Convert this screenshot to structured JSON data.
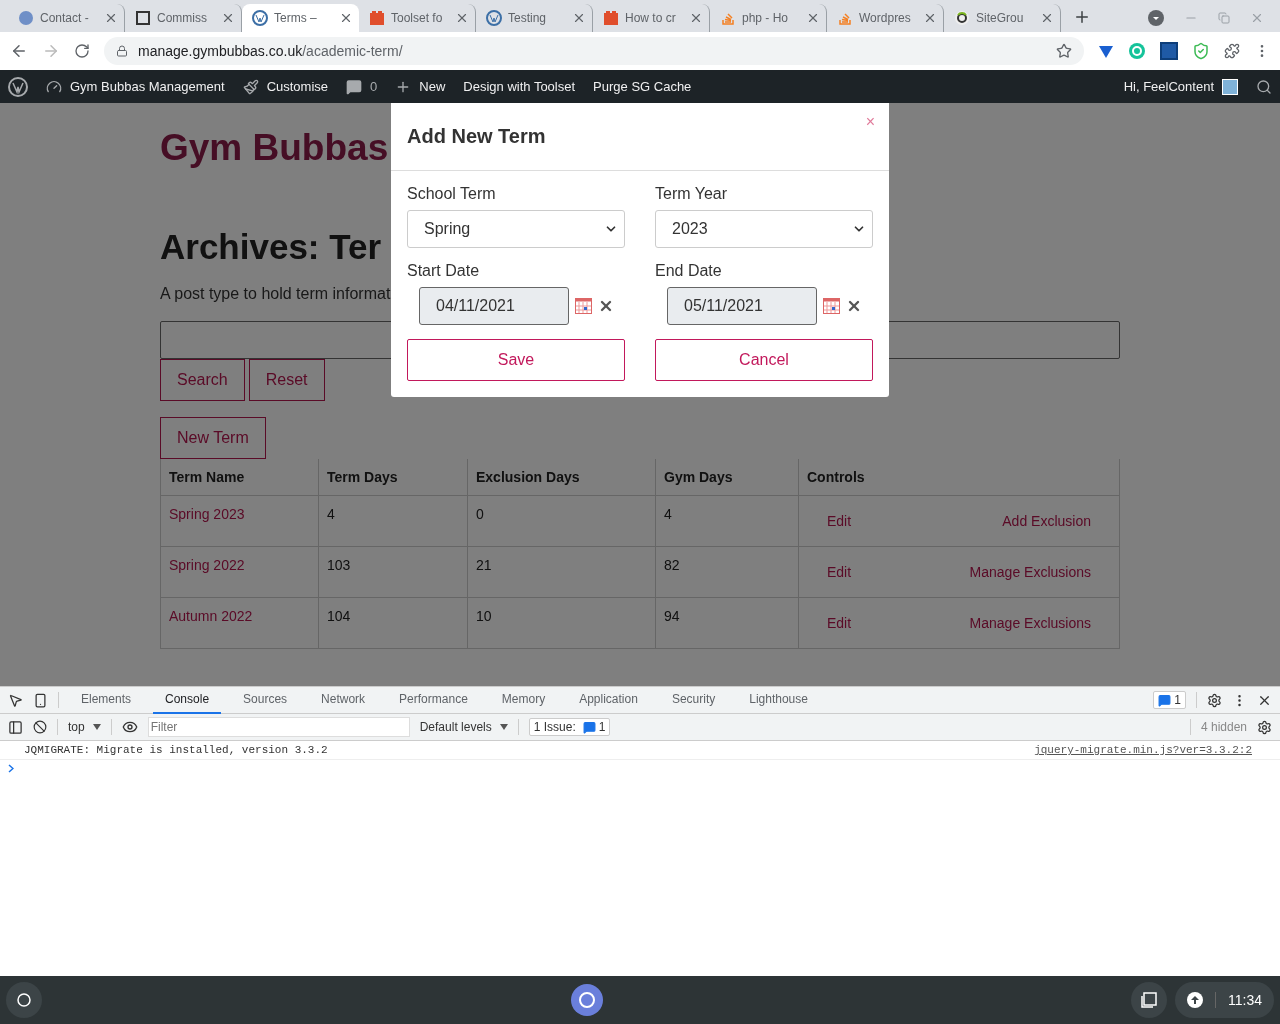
{
  "browser": {
    "tabs": [
      {
        "title": "Contact -",
        "kind": "circle",
        "selected": false
      },
      {
        "title": "Commiss",
        "kind": "frame",
        "selected": false
      },
      {
        "title": "Terms –",
        "kind": "wordpress",
        "selected": true
      },
      {
        "title": "Toolset fo",
        "kind": "block",
        "selected": false
      },
      {
        "title": "Testing",
        "kind": "wordpress",
        "selected": false
      },
      {
        "title": "How to cr",
        "kind": "block",
        "selected": false
      },
      {
        "title": "php - Ho",
        "kind": "stack",
        "selected": false
      },
      {
        "title": "Wordpres",
        "kind": "stack",
        "selected": false
      },
      {
        "title": "SiteGrou",
        "kind": "swirl",
        "selected": false
      }
    ],
    "url": {
      "host": "manage.gymbubbas.co.uk",
      "path": "/academic-term/"
    }
  },
  "admin_bar": {
    "site": "Gym Bubbas Management",
    "customise": "Customise",
    "comments": "0",
    "new": "New",
    "links": [
      "Design with Toolset",
      "Purge SG Cache"
    ],
    "greeting": "Hi, FeelContent"
  },
  "page": {
    "site_title": "Gym Bubbas",
    "archive_title": "Archives: Ter",
    "description": "A post type to hold term informat",
    "search_button": "Search",
    "reset_button": "Reset",
    "new_button": "New Term",
    "table": {
      "columns": [
        "Term Name",
        "Term Days",
        "Exclusion Days",
        "Gym Days",
        "Controls"
      ],
      "rows": [
        {
          "name": "Spring 2023",
          "term_days": "4",
          "exclusion_days": "0",
          "gym_days": "4",
          "edit": "Edit",
          "exclusions": "Add Exclusion"
        },
        {
          "name": "Spring 2022",
          "term_days": "103",
          "exclusion_days": "21",
          "gym_days": "82",
          "edit": "Edit",
          "exclusions": "Manage Exclusions"
        },
        {
          "name": "Autumn 2022",
          "term_days": "104",
          "exclusion_days": "10",
          "gym_days": "94",
          "edit": "Edit",
          "exclusions": "Manage Exclusions"
        }
      ]
    }
  },
  "modal": {
    "title": "Add New Term",
    "close": "×",
    "school_term": {
      "label": "School Term",
      "value": "Spring"
    },
    "term_year": {
      "label": "Term Year",
      "value": "2023"
    },
    "start_date": {
      "label": "Start Date",
      "value": "04/11/2021"
    },
    "end_date": {
      "label": "End Date",
      "value": "05/11/2021"
    },
    "save": "Save",
    "cancel": "Cancel"
  },
  "devtools": {
    "tabs": [
      {
        "label": "Elements",
        "selected": false
      },
      {
        "label": "Console",
        "selected": true
      },
      {
        "label": "Sources",
        "selected": false
      },
      {
        "label": "Network",
        "selected": false
      },
      {
        "label": "Performance",
        "selected": false
      },
      {
        "label": "Memory",
        "selected": false
      },
      {
        "label": "Application",
        "selected": false
      },
      {
        "label": "Security",
        "selected": false
      },
      {
        "label": "Lighthouse",
        "selected": false
      }
    ],
    "issue_count": "1",
    "context": "top",
    "filter_placeholder": "Filter",
    "levels": "Default levels",
    "issues_label": "1 Issue:",
    "issues_count": "1",
    "hidden": "4 hidden",
    "messages": [
      {
        "text": "JQMIGRATE: Migrate is installed, version 3.3.2",
        "source": "jquery-migrate.min.js?ver=3.3.2:2"
      }
    ]
  },
  "taskbar": {
    "time": "11:34"
  }
}
